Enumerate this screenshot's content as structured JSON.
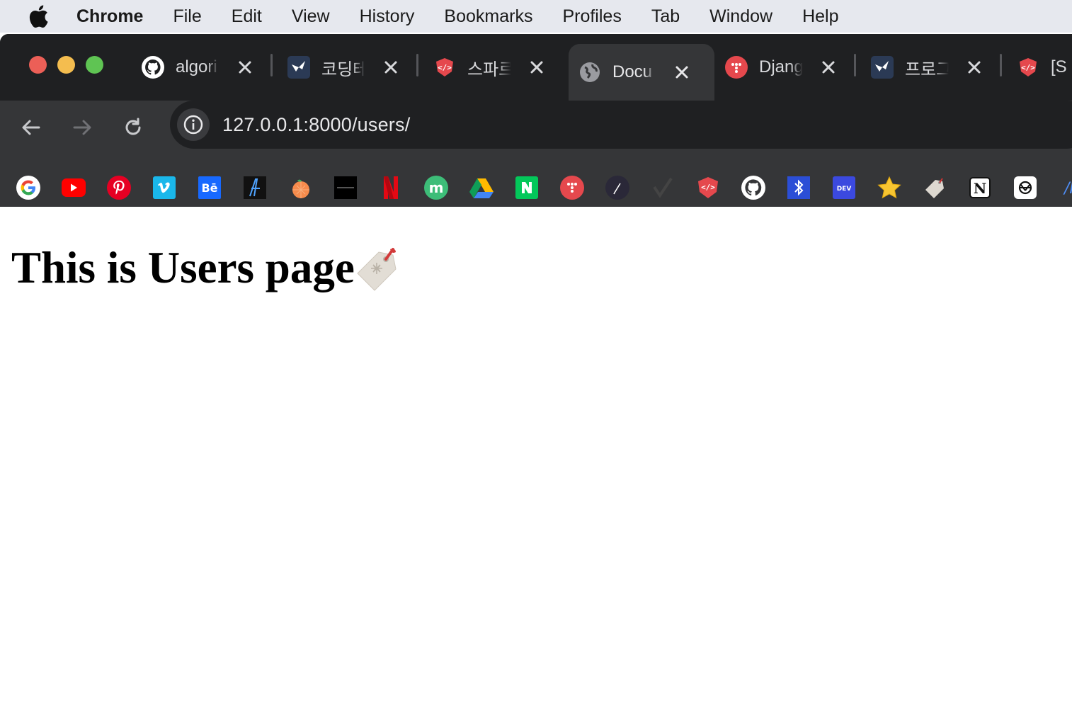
{
  "menubar": {
    "items": [
      "Chrome",
      "File",
      "Edit",
      "View",
      "History",
      "Bookmarks",
      "Profiles",
      "Tab",
      "Window",
      "Help"
    ]
  },
  "tabs": [
    {
      "title": "algori",
      "icon": "github-icon"
    },
    {
      "title": "코딩테",
      "icon": "programmers-icon"
    },
    {
      "title": "스파르",
      "icon": "sparta-icon"
    },
    {
      "title": "Docu",
      "icon": "globe-icon",
      "active": true
    },
    {
      "title": "Djang",
      "icon": "django-tutorial-icon"
    },
    {
      "title": "프로그",
      "icon": "programmers-icon"
    },
    {
      "title": "[S",
      "icon": "sparta-icon"
    }
  ],
  "address_bar": {
    "url": "127.0.0.1:8000/users/"
  },
  "bookmarks": [
    "google-icon",
    "youtube-icon",
    "pinterest-icon",
    "vimeo-icon",
    "behance-icon",
    "a-logo-icon",
    "orange-icon",
    "dark-banner-icon",
    "netflix-icon",
    "m-logo-icon",
    "google-drive-icon",
    "naver-icon",
    "dots-logo-icon",
    "pen-logo-icon",
    "check-logo-icon",
    "sparta-icon",
    "github-icon",
    "bluetooth-logo-icon",
    "dev-icon",
    "star-icon",
    "tag-icon",
    "notion-icon",
    "openai-icon",
    "k-logo-icon"
  ],
  "page": {
    "heading": "This is Users page"
  },
  "colors": {
    "accent_red": "#e5484d",
    "frame": "#1f2022",
    "toolbar": "#353638"
  }
}
